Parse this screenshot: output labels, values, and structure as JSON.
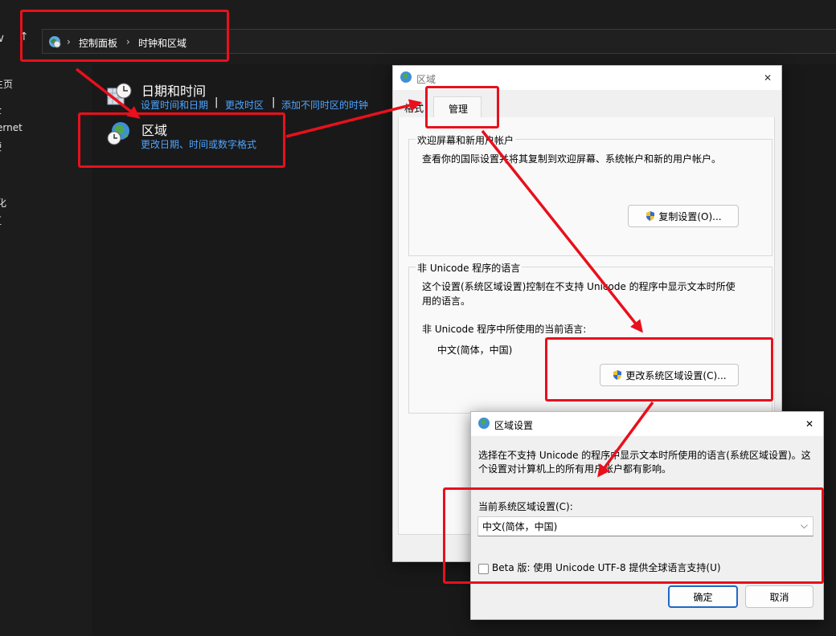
{
  "explorer": {
    "nav": {
      "down": "∨",
      "up": "↑"
    },
    "breadcrumb": [
      "控制面板",
      "时钟和区域"
    ],
    "sidebar": [
      "主页",
      "全",
      "ernet",
      "硬",
      "化",
      "区"
    ]
  },
  "control_panel": {
    "datetime": {
      "title": "日期和时间",
      "links": [
        "设置时间和日期",
        "更改时区",
        "添加不同时区的时钟"
      ]
    },
    "region": {
      "title": "区域",
      "link": "更改日期、时间或数字格式"
    }
  },
  "region_dialog": {
    "title": "区域",
    "tabs": [
      "格式",
      "管理"
    ],
    "welcome_group": {
      "legend": "欢迎屏幕和新用户帐户",
      "description": "查看你的国际设置并将其复制到欢迎屏幕、系统帐户和新的用户帐户。",
      "copy_button": "复制设置(O)..."
    },
    "unicode_group": {
      "legend": "非 Unicode 程序的语言",
      "description_line1": "这个设置(系统区域设置)控制在不支持 Unicode 的程序中显示文本时所使",
      "description_line2": "用的语言。",
      "current_label": "非 Unicode 程序中所使用的当前语言:",
      "current_value": "中文(简体，中国)",
      "change_button": "更改系统区域设置(C)..."
    }
  },
  "region_settings_dialog": {
    "title": "区域设置",
    "description_line1": "选择在不支持 Unicode 的程序中显示文本时所使用的语言(系统区域设置)。这",
    "description_line2": "个设置对计算机上的所有用户帐户都有影响。",
    "current_locale_label": "当前系统区域设置(C):",
    "current_locale_value": "中文(简体，中国)",
    "beta_checkbox_label": "Beta 版: 使用 Unicode UTF-8 提供全球语言支持(U)",
    "beta_checked": false,
    "ok_button": "确定",
    "cancel_button": "取消"
  },
  "colors": {
    "annotation_red": "#e8101c",
    "link_blue": "#4ea4ff",
    "dark_bg": "#191919"
  }
}
